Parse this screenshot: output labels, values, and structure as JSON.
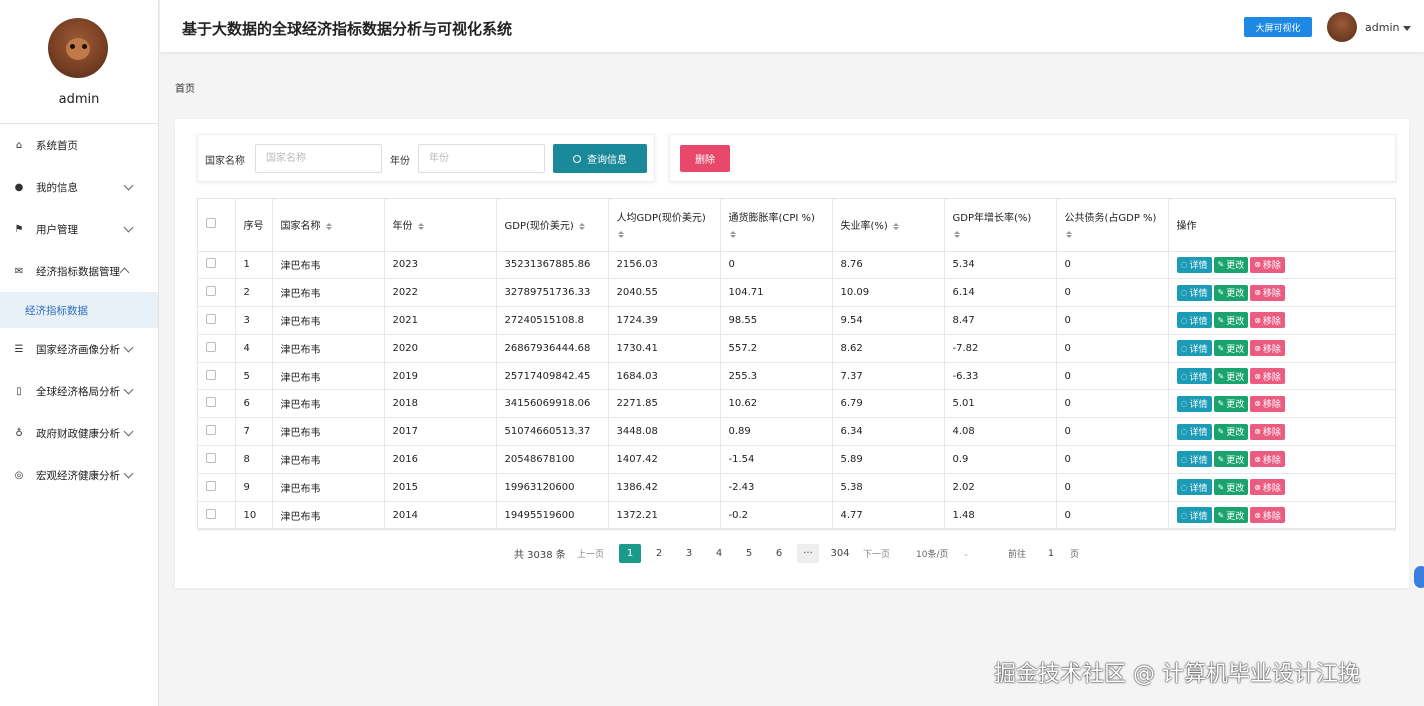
{
  "profile": {
    "name": "admin"
  },
  "sidebar": {
    "items": [
      {
        "label": "系统首页",
        "icon": "home-icon"
      },
      {
        "label": "我的信息",
        "icon": "user-icon"
      },
      {
        "label": "用户管理",
        "icon": "flag-icon"
      },
      {
        "label": "经济指标数据管理",
        "icon": "mail-icon"
      },
      {
        "label": "经济指标数据",
        "icon": ""
      },
      {
        "label": "国家经济画像分析",
        "icon": "sliders-icon"
      },
      {
        "label": "全球经济格局分析",
        "icon": "phone-icon"
      },
      {
        "label": "政府财政健康分析",
        "icon": "mic-icon"
      },
      {
        "label": "宏观经济健康分析",
        "icon": "target-icon"
      }
    ]
  },
  "header": {
    "title": "基于大数据的全球经济指标数据分析与可视化系统",
    "bigscreen_button": "大屏可视化",
    "user": "admin"
  },
  "breadcrumb": "首页",
  "search": {
    "country_label": "国家名称",
    "country_placeholder": "国家名称",
    "year_label": "年份",
    "year_placeholder": "年份",
    "query_button": "查询信息"
  },
  "actions": {
    "delete_button": "删除"
  },
  "table": {
    "headers": [
      "序号",
      "国家名称",
      "年份",
      "GDP(现价美元)",
      "人均GDP(现价美元)",
      "通货膨胀率(CPI %)",
      "失业率(%)",
      "GDP年增长率(%)",
      "公共债务(占GDP %)",
      "操作"
    ],
    "row_buttons": {
      "detail": "详情",
      "edit": "更改",
      "remove": "移除"
    },
    "rows": [
      [
        "1",
        "津巴布韦",
        "2023",
        "35231367885.86",
        "2156.03",
        "0",
        "8.76",
        "5.34",
        "0"
      ],
      [
        "2",
        "津巴布韦",
        "2022",
        "32789751736.33",
        "2040.55",
        "104.71",
        "10.09",
        "6.14",
        "0"
      ],
      [
        "3",
        "津巴布韦",
        "2021",
        "27240515108.8",
        "1724.39",
        "98.55",
        "9.54",
        "8.47",
        "0"
      ],
      [
        "4",
        "津巴布韦",
        "2020",
        "26867936444.68",
        "1730.41",
        "557.2",
        "8.62",
        "-7.82",
        "0"
      ],
      [
        "5",
        "津巴布韦",
        "2019",
        "25717409842.45",
        "1684.03",
        "255.3",
        "7.37",
        "-6.33",
        "0"
      ],
      [
        "6",
        "津巴布韦",
        "2018",
        "34156069918.06",
        "2271.85",
        "10.62",
        "6.79",
        "5.01",
        "0"
      ],
      [
        "7",
        "津巴布韦",
        "2017",
        "51074660513.37",
        "3448.08",
        "0.89",
        "6.34",
        "4.08",
        "0"
      ],
      [
        "8",
        "津巴布韦",
        "2016",
        "20548678100",
        "1407.42",
        "-1.54",
        "5.89",
        "0.9",
        "0"
      ],
      [
        "9",
        "津巴布韦",
        "2015",
        "19963120600",
        "1386.42",
        "-2.43",
        "5.38",
        "2.02",
        "0"
      ],
      [
        "10",
        "津巴布韦",
        "2014",
        "19495519600",
        "1372.21",
        "-0.2",
        "4.77",
        "1.48",
        "0"
      ]
    ]
  },
  "pagination": {
    "total": "共 3038 条",
    "prev": "上一页",
    "pages": [
      "1",
      "2",
      "3",
      "4",
      "5",
      "6"
    ],
    "ellipsis": "···",
    "last": "304",
    "next": "下一页",
    "page_size": "10条/页",
    "goto_label": "前往",
    "goto_value": "1",
    "goto_suffix": "页",
    "current": 1
  },
  "watermark": "掘金技术社区 @ 计算机毕业设计江挽"
}
